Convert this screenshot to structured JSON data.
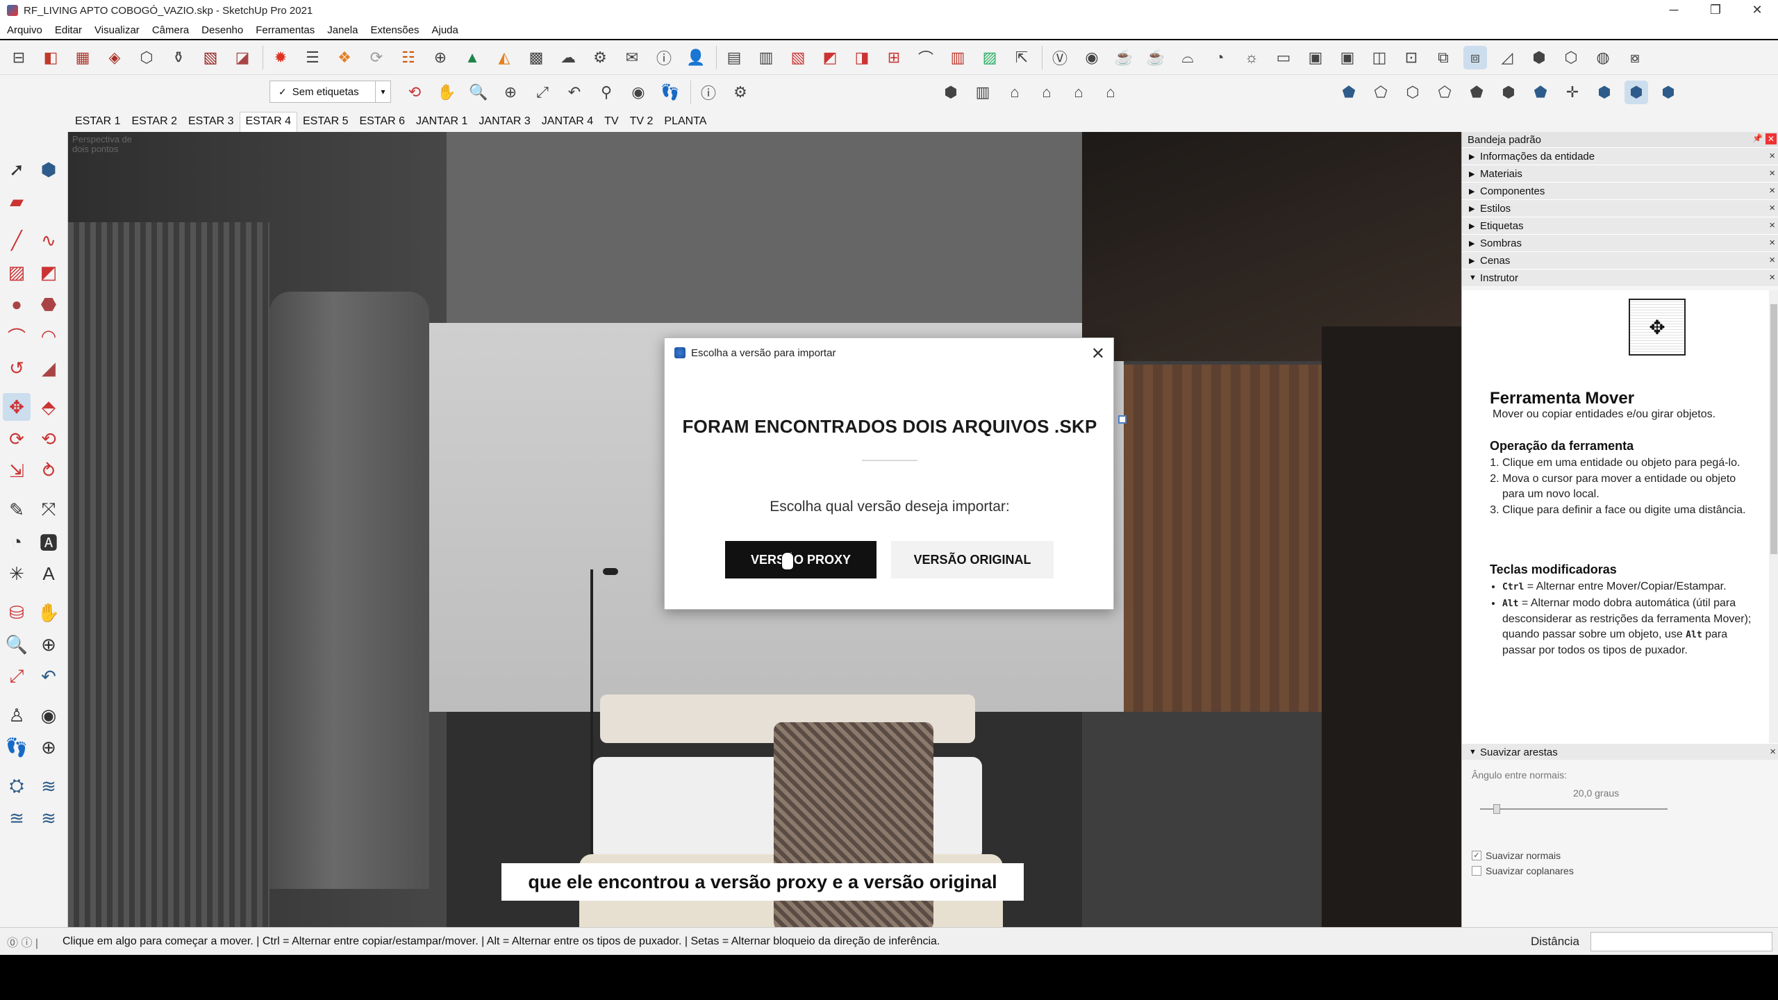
{
  "window": {
    "title": "RF_LIVING APTO COBOGÓ_VAZIO.skp - SketchUp Pro 2021",
    "controls": [
      "─",
      "❐",
      "✕"
    ]
  },
  "menu": [
    "Arquivo",
    "Editar",
    "Visualizar",
    "Câmera",
    "Desenho",
    "Ferramentas",
    "Janela",
    "Extensões",
    "Ajuda"
  ],
  "toolbar": {
    "tag_filter": "Sem etiquetas"
  },
  "scenes": [
    "ESTAR 1",
    "ESTAR 2",
    "ESTAR 3",
    "ESTAR 4",
    "ESTAR 5",
    "ESTAR 6",
    "JANTAR 1",
    "JANTAR 3",
    "JANTAR 4",
    "TV",
    "TV 2",
    "PLANTA"
  ],
  "active_scene": "ESTAR 4",
  "viewport": {
    "perspective_label": "Perspectiva de dois pontos"
  },
  "dialog": {
    "title": "Escolha a versão para importar",
    "heading": "FORAM ENCONTRADOS DOIS ARQUIVOS .SKP",
    "prompt": "Escolha qual versão deseja importar:",
    "proxy_button": "VERSÃO PROXY",
    "original_button": "VERSÃO ORIGINAL"
  },
  "subtitle": "que ele encontrou a versão proxy e a versão original",
  "tray": {
    "title": "Bandeja padrão",
    "panels": [
      "Informações da entidade",
      "Materiais",
      "Componentes",
      "Estilos",
      "Etiquetas",
      "Sombras",
      "Cenas",
      "Instrutor"
    ],
    "instructor": {
      "tool_name": "Ferramenta Mover",
      "tool_desc": "Mover ou copiar entidades e/ou girar objetos.",
      "operation_title": "Operação da ferramenta",
      "steps": [
        "Clique em uma entidade ou objeto para pegá-lo.",
        "Mova o cursor para mover a entidade ou objeto para um novo local.",
        "Clique para definir a face ou digite uma distância."
      ],
      "modifiers_title": "Teclas modificadoras",
      "modifiers": [
        {
          "key": "Ctrl",
          "text": " = Alternar entre Mover/Copiar/Estampar."
        },
        {
          "key": "Alt",
          "text": " = Alternar modo dobra automática (útil para desconsiderar as restrições da ferramenta Mover); quando passar sobre um objeto, use "
        },
        {
          "key": "Alt",
          "text": " para passar por todos os tipos de puxador."
        }
      ]
    },
    "smooth": {
      "title": "Suavizar arestas",
      "angle_label": "Ângulo entre normais:",
      "angle_value": "20,0  graus",
      "angle_fraction": 0.09,
      "smooth_normals": "Suavizar normais",
      "smooth_coplanar": "Suavizar coplanares"
    }
  },
  "status": {
    "message": "Clique em algo para começar a mover. | Ctrl = Alternar entre copiar/estampar/mover. | Alt = Alternar entre os tipos de puxador. | Setas = Alternar bloqueio da direção de inferência.",
    "measurement_label": "Distância",
    "measurement_value": ""
  }
}
